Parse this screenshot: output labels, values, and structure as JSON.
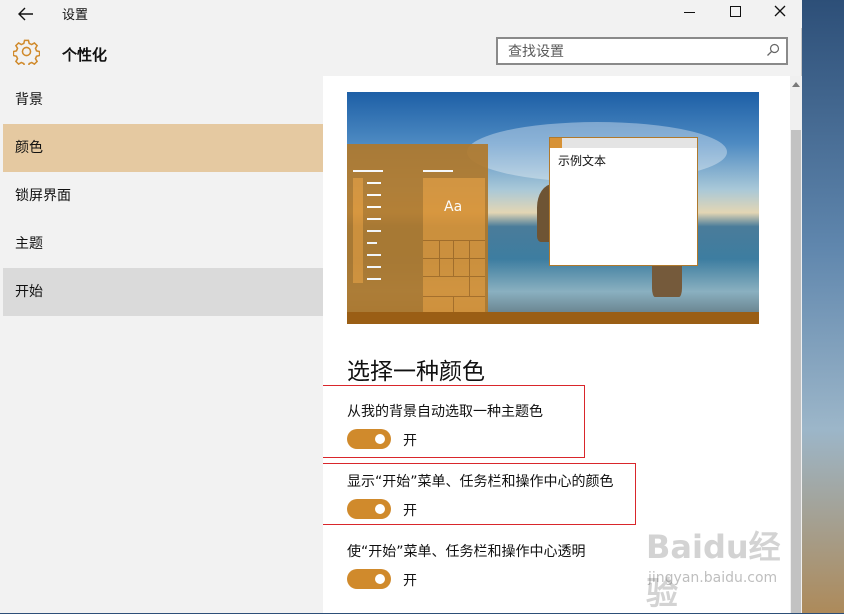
{
  "window": {
    "title": "设置",
    "back_icon": "arrow-left-icon",
    "controls": [
      "minimize-icon",
      "maximize-icon",
      "close-icon"
    ]
  },
  "header": {
    "icon": "gear-icon",
    "title": "个性化",
    "search_placeholder": "查找设置",
    "search_icon": "search-icon"
  },
  "sidebar": {
    "items": [
      {
        "label": "背景"
      },
      {
        "label": "颜色"
      },
      {
        "label": "锁屏界面"
      },
      {
        "label": "主题"
      },
      {
        "label": "开始"
      }
    ],
    "selected": "颜色",
    "hovered": "开始"
  },
  "preview": {
    "tile_label": "Aa",
    "sample_window_text": "示例文本"
  },
  "colors_section": {
    "heading": "选择一种颜色",
    "settings": [
      {
        "label": "从我的背景自动选取一种主题色",
        "state": "开",
        "on": true
      },
      {
        "label": "显示“开始”菜单、任务栏和操作中心的颜色",
        "state": "开",
        "on": true
      },
      {
        "label": "使“开始”菜单、任务栏和操作中心透明",
        "state": "开",
        "on": true
      }
    ]
  },
  "theme": {
    "accent": "#D08A2C",
    "selected_nav": "#E5C9A1",
    "highlight_box": "#D9262B"
  },
  "watermark": {
    "brand": "Baidu经验",
    "url": "jingyan.baidu.com"
  }
}
